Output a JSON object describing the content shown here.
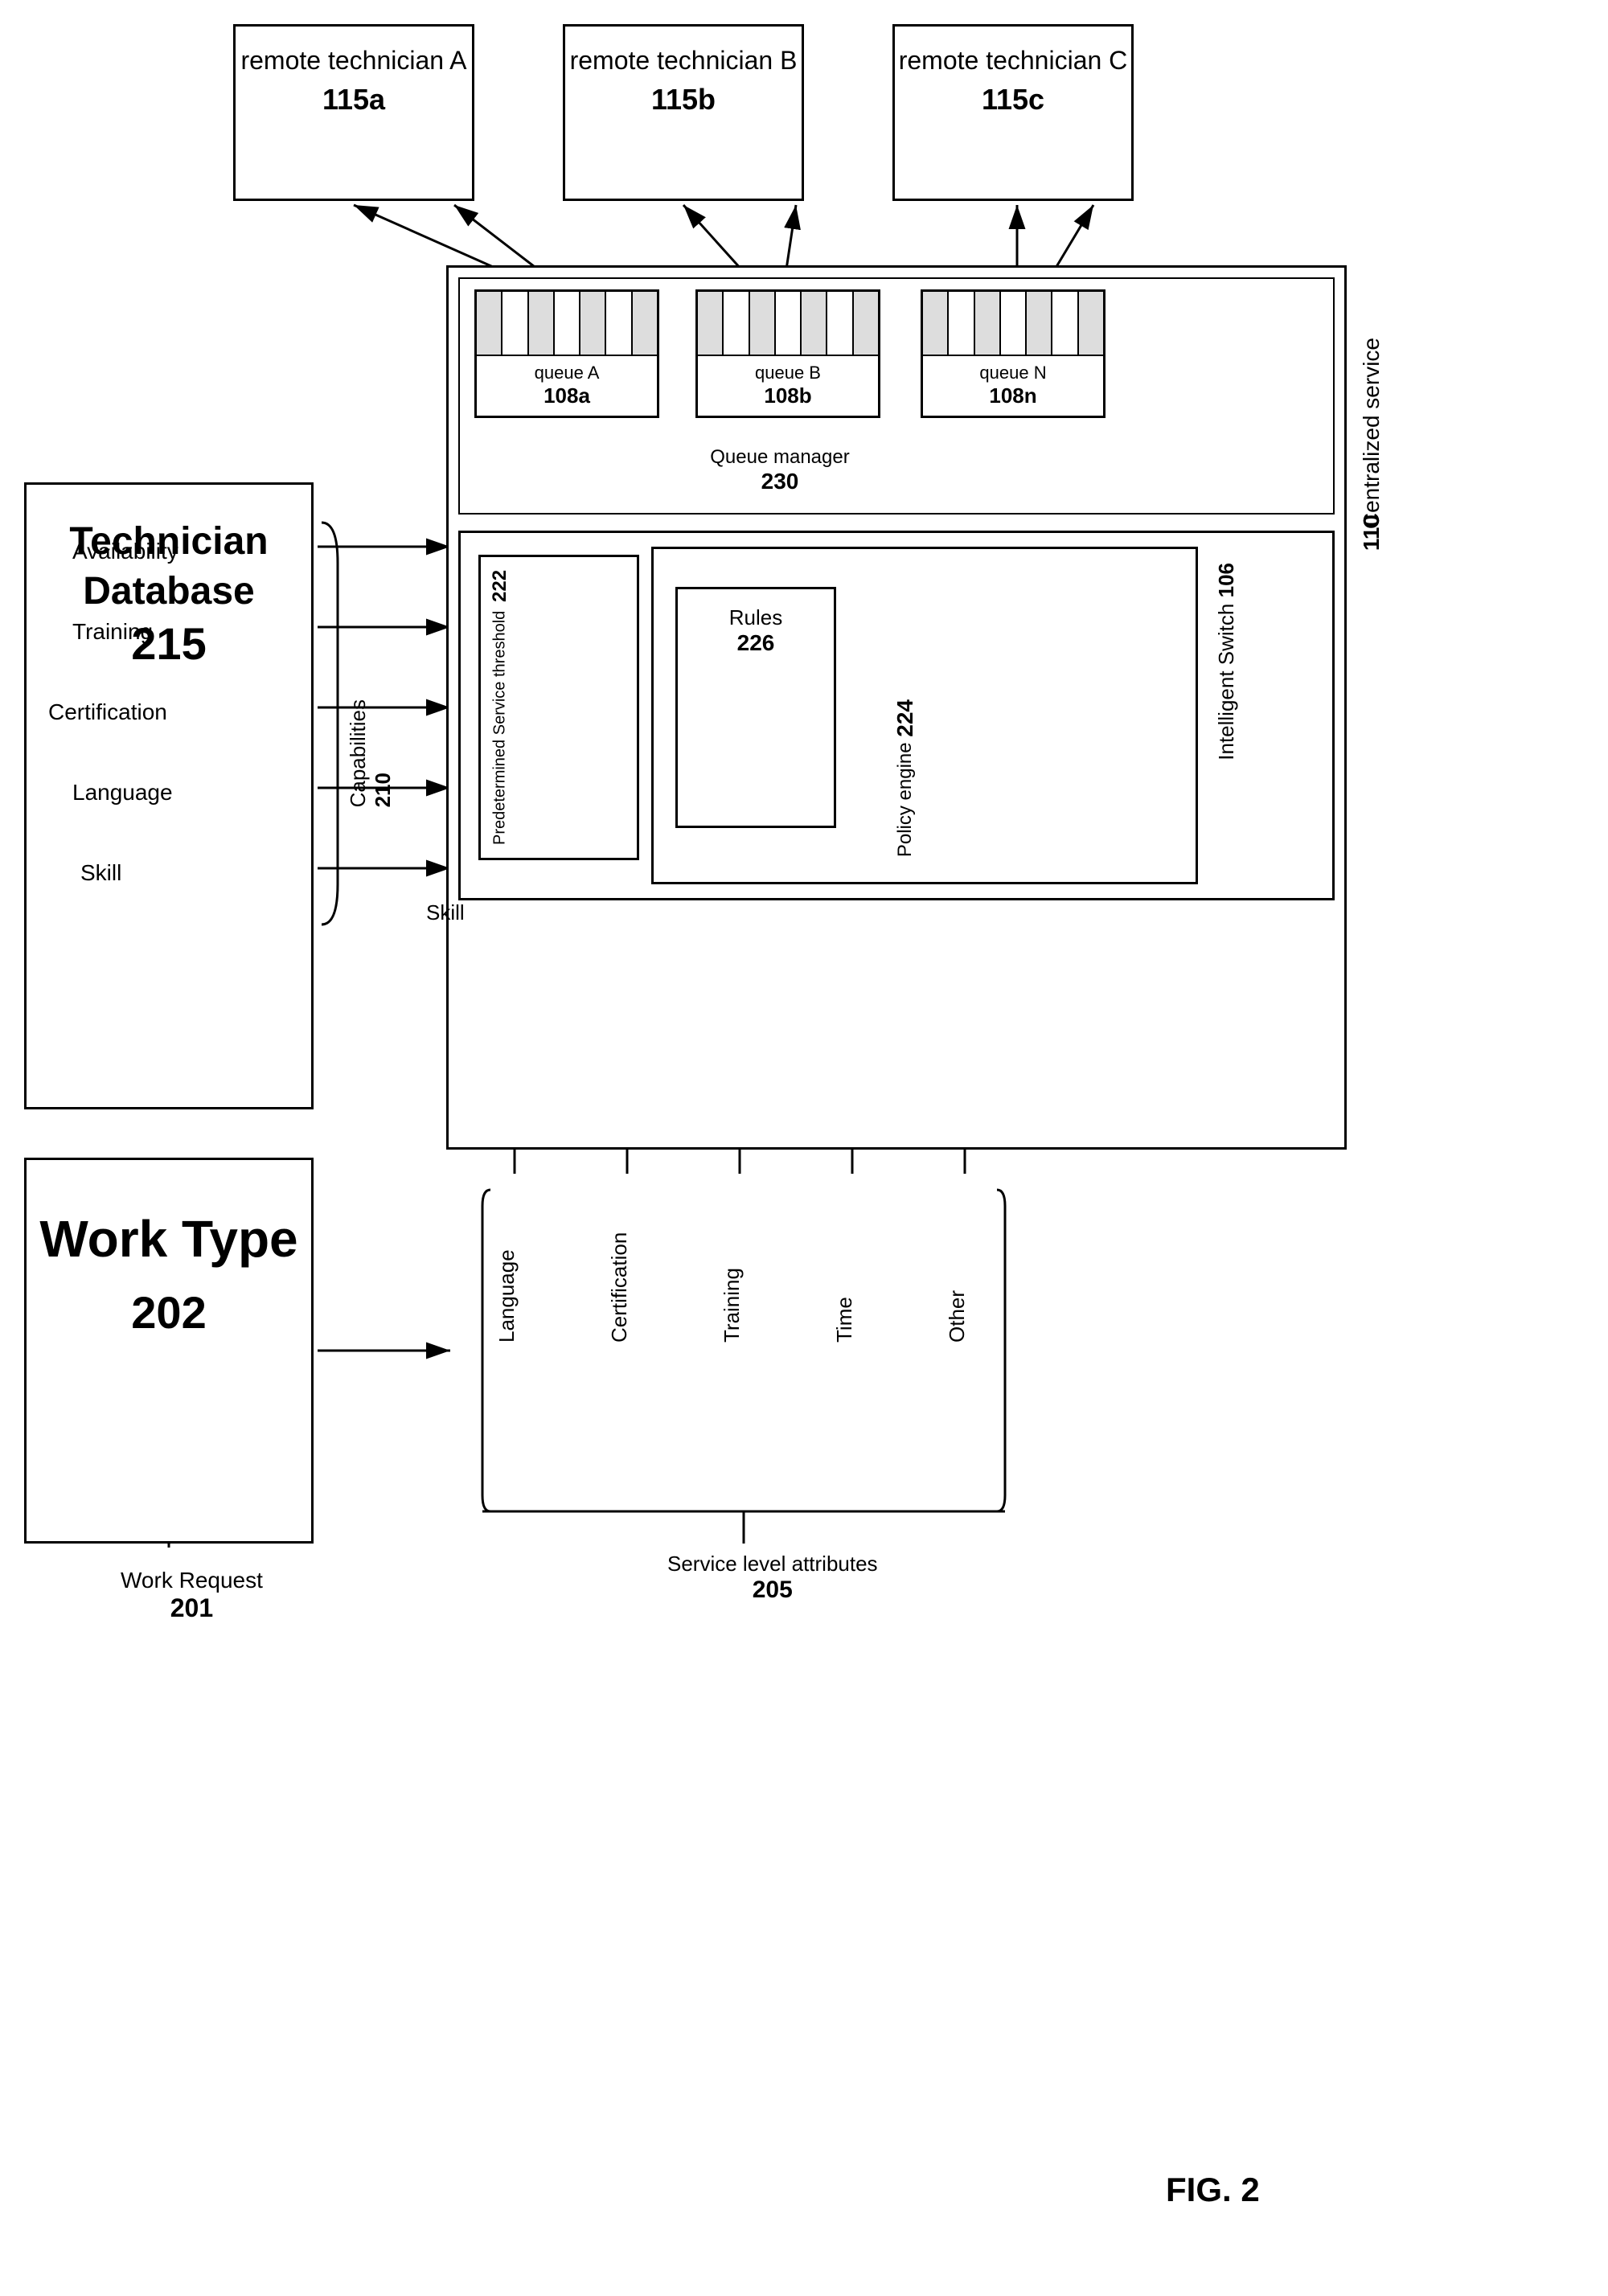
{
  "diagram": {
    "title": "FIG. 2",
    "remote_technicians": [
      {
        "label": "remote technician A",
        "id": "115a"
      },
      {
        "label": "remote technician B",
        "id": "115b"
      },
      {
        "label": "remote technician C",
        "id": "115c"
      }
    ],
    "tech_database": {
      "label": "Technician Database",
      "id": "215",
      "attributes": [
        "Availability",
        "Training",
        "Certification",
        "Language",
        "Skill"
      ]
    },
    "centralized_service": {
      "label": "Centralized service",
      "id": "110"
    },
    "queues": [
      {
        "label": "queue A",
        "id": "108a"
      },
      {
        "label": "queue B",
        "id": "108b"
      },
      {
        "label": "queue N",
        "id": "108n"
      }
    ],
    "queue_manager": {
      "label": "Queue manager",
      "id": "230"
    },
    "intelligent_switch": {
      "label": "Intelligent Switch",
      "id": "106"
    },
    "policy_engine": {
      "label": "Policy engine",
      "id": "224"
    },
    "predetermined": {
      "label": "Predetermined Service threshold",
      "id": "222"
    },
    "rules": {
      "label": "Rules",
      "id": "226"
    },
    "work_type": {
      "label": "Work Type",
      "id": "202"
    },
    "work_request": {
      "label": "Work Request",
      "id": "201"
    },
    "capabilities": {
      "label": "Capabilities",
      "id": "210"
    },
    "skill_label": "Skill",
    "service_level_attributes": {
      "label": "Service level attributes",
      "id": "205",
      "items": [
        "Language",
        "Certification",
        "Training",
        "Time",
        "Other"
      ]
    }
  }
}
